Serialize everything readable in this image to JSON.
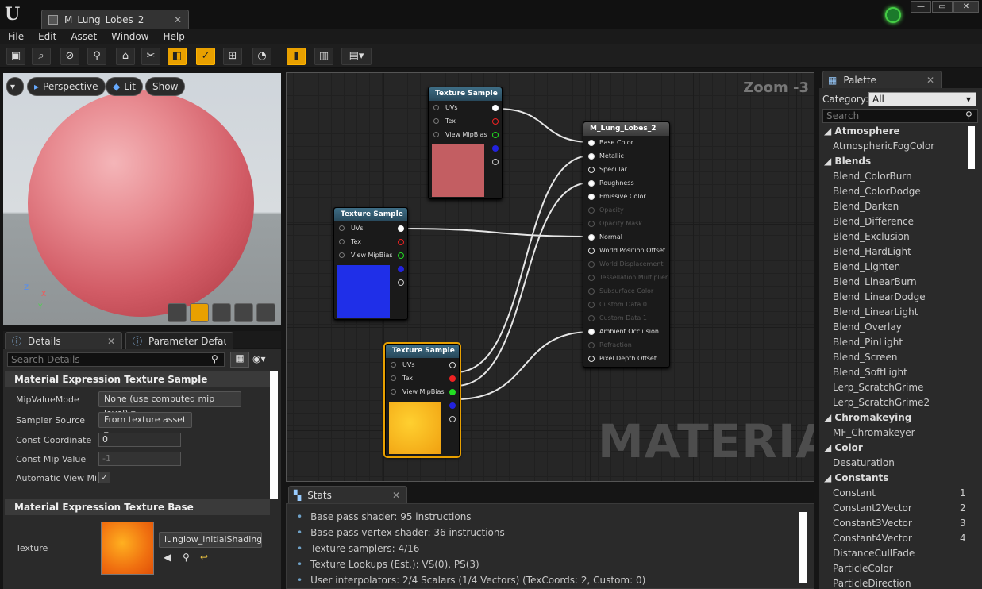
{
  "window": {
    "doc_tab": "M_Lung_Lobes_2",
    "min": "—",
    "max": "▭",
    "close": "✕"
  },
  "menu": [
    "File",
    "Edit",
    "Asset",
    "Window",
    "Help"
  ],
  "viewport": {
    "mode": "Perspective",
    "lit": "Lit",
    "show": "Show",
    "axis_x": "X",
    "axis_y": "Y",
    "axis_z": "Z"
  },
  "details": {
    "tab": "Details",
    "tab2": "Parameter Defaults",
    "search_placeholder": "Search Details",
    "section1": "Material Expression Texture Sample",
    "mipvaluemode_label": "MipValueMode",
    "mipvaluemode_value": "None (use computed mip level)",
    "sampler_label": "Sampler Source",
    "sampler_value": "From texture asset",
    "constcoord_label": "Const Coordinate",
    "constcoord_value": "0",
    "constmip_label": "Const Mip Value",
    "constmip_value": "-1",
    "autoviewmip_label": "Automatic View Mip",
    "section2": "Material Expression Texture Base",
    "texture_label": "Texture",
    "texture_value": "lunglow_initialShading("
  },
  "graph": {
    "zoom": "Zoom -3",
    "watermark": "MATERIAL",
    "node_top": {
      "title": "Texture Sample",
      "pins": [
        "UVs",
        "Tex",
        "View MipBias"
      ]
    },
    "node_mid": {
      "title": "Texture Sample",
      "pins": [
        "UVs",
        "Tex",
        "View MipBias"
      ]
    },
    "node_bot": {
      "title": "Texture Sample",
      "pins": [
        "UVs",
        "Tex",
        "View MipBias"
      ]
    },
    "material": {
      "title": "M_Lung_Lobes_2",
      "inputs": [
        "Base Color",
        "Metallic",
        "Specular",
        "Roughness",
        "Emissive Color",
        "Opacity",
        "Opacity Mask",
        "Normal",
        "World Position Offset",
        "World Displacement",
        "Tessellation Multiplier",
        "Subsurface Color",
        "Custom Data 0",
        "Custom Data 1",
        "Ambient Occlusion",
        "Refraction",
        "Pixel Depth Offset"
      ]
    }
  },
  "stats": {
    "tab": "Stats",
    "lines": [
      "Base pass shader: 95 instructions",
      "Base pass vertex shader: 36 instructions",
      "Texture samplers: 4/16",
      "Texture Lookups (Est.): VS(0), PS(3)",
      "User interpolators: 2/4 Scalars (1/4 Vectors) (TexCoords: 2, Custom: 0)"
    ]
  },
  "palette": {
    "tab": "Palette",
    "category_label": "Category:",
    "category_value": "All",
    "search_placeholder": "Search",
    "rows": [
      {
        "t": "cat",
        "l": "Atmosphere"
      },
      {
        "t": "item",
        "l": "AtmosphericFogColor"
      },
      {
        "t": "cat",
        "l": "Blends"
      },
      {
        "t": "item",
        "l": "Blend_ColorBurn"
      },
      {
        "t": "item",
        "l": "Blend_ColorDodge"
      },
      {
        "t": "item",
        "l": "Blend_Darken"
      },
      {
        "t": "item",
        "l": "Blend_Difference"
      },
      {
        "t": "item",
        "l": "Blend_Exclusion"
      },
      {
        "t": "item",
        "l": "Blend_HardLight"
      },
      {
        "t": "item",
        "l": "Blend_Lighten"
      },
      {
        "t": "item",
        "l": "Blend_LinearBurn"
      },
      {
        "t": "item",
        "l": "Blend_LinearDodge"
      },
      {
        "t": "item",
        "l": "Blend_LinearLight"
      },
      {
        "t": "item",
        "l": "Blend_Overlay"
      },
      {
        "t": "item",
        "l": "Blend_PinLight"
      },
      {
        "t": "item",
        "l": "Blend_Screen"
      },
      {
        "t": "item",
        "l": "Blend_SoftLight"
      },
      {
        "t": "item",
        "l": "Lerp_ScratchGrime"
      },
      {
        "t": "item",
        "l": "Lerp_ScratchGrime2"
      },
      {
        "t": "cat",
        "l": "Chromakeying"
      },
      {
        "t": "item",
        "l": "MF_Chromakeyer"
      },
      {
        "t": "cat",
        "l": "Color"
      },
      {
        "t": "item",
        "l": "Desaturation"
      },
      {
        "t": "cat",
        "l": "Constants"
      },
      {
        "t": "item",
        "l": "Constant",
        "n": "1"
      },
      {
        "t": "item",
        "l": "Constant2Vector",
        "n": "2"
      },
      {
        "t": "item",
        "l": "Constant3Vector",
        "n": "3"
      },
      {
        "t": "item",
        "l": "Constant4Vector",
        "n": "4"
      },
      {
        "t": "item",
        "l": "DistanceCullFade"
      },
      {
        "t": "item",
        "l": "ParticleColor"
      },
      {
        "t": "item",
        "l": "ParticleDirection"
      }
    ]
  }
}
